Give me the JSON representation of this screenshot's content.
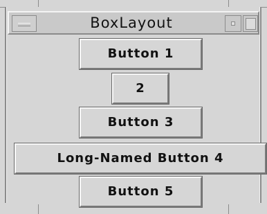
{
  "window": {
    "title": "BoxLayout",
    "menu_icon": "window-menu-icon",
    "minimize_icon": "minimize-icon",
    "maximize_icon": "maximize-icon"
  },
  "buttons": [
    {
      "label": "Button 1"
    },
    {
      "label": "2"
    },
    {
      "label": "Button 3"
    },
    {
      "label": "Long-Named Button 4"
    },
    {
      "label": "Button 5"
    }
  ]
}
